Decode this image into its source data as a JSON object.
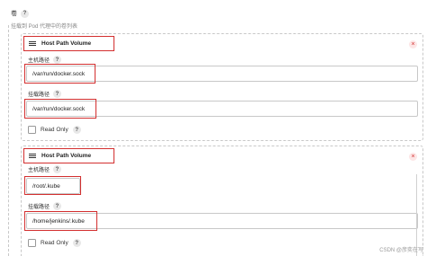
{
  "section": {
    "label": "卷",
    "description": "挂载到 Pod 代理中的卷列表"
  },
  "volumes": [
    {
      "type": "Host Path Volume",
      "host_path_label": "主机路径",
      "host_path_value": "/var/run/docker.sock",
      "mount_path_label": "挂载路径",
      "mount_path_value": "/var/run/docker.sock",
      "read_only_label": "Read Only",
      "read_only": false
    },
    {
      "type": "Host Path Volume",
      "host_path_label": "主机路径",
      "host_path_value": "/root/.kube",
      "mount_path_label": "挂载路径",
      "mount_path_value": "/home/jenkins/.kube",
      "read_only_label": "Read Only",
      "read_only": false
    }
  ],
  "icons": {
    "help": "?",
    "close": "×",
    "drag": "drag-handle-icon"
  },
  "colors": {
    "highlight": "#d32f2f",
    "border": "#c8c8c8"
  },
  "watermark": "CSDN @彦奕在写"
}
